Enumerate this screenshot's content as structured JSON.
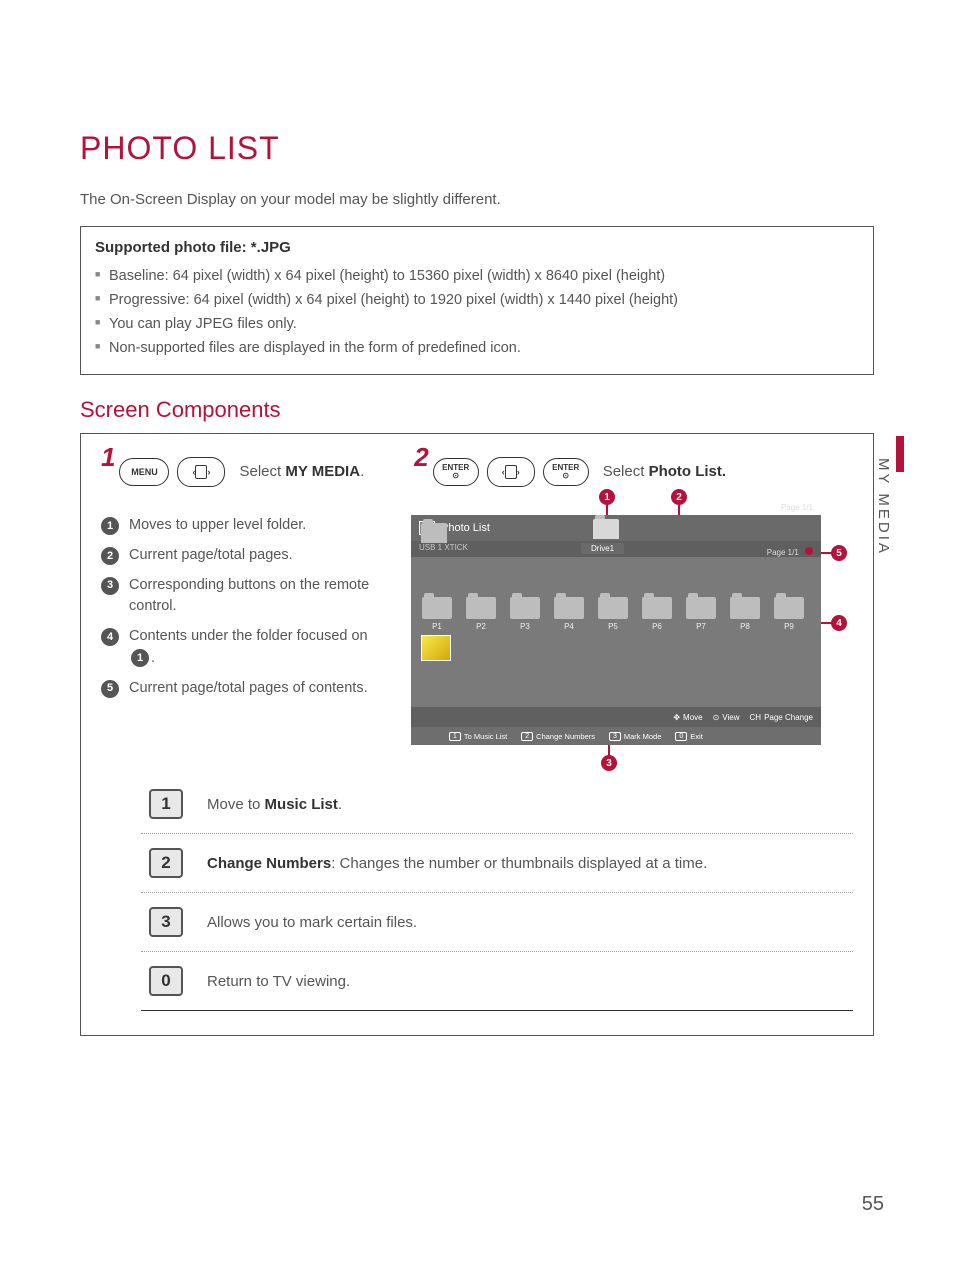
{
  "title": "PHOTO LIST",
  "intro": "The On-Screen Display on your model may be slightly different.",
  "support": {
    "heading": "Supported photo file: *.JPG",
    "items": [
      "Baseline: 64 pixel (width) x 64 pixel (height) to 15360 pixel (width) x 8640 pixel (height)",
      "Progressive: 64 pixel (width) x 64 pixel (height) to 1920 pixel (width) x 1440 pixel (height)",
      "You can play JPEG files only.",
      "Non-supported files are displayed in the form of predefined icon."
    ]
  },
  "screen_components_heading": "Screen Components",
  "steps": {
    "s1_num": "1",
    "s1_menu": "MENU",
    "s1_text_a": "Select ",
    "s1_text_b": "MY MEDIA",
    "s1_text_c": ".",
    "s2_num": "2",
    "s2_enter": "ENTER",
    "s2_text_a": "Select ",
    "s2_text_b": "Photo List.",
    "s2_text_c": ""
  },
  "legend": [
    {
      "n": "1",
      "t": "Moves to upper level folder."
    },
    {
      "n": "2",
      "t": "Current page/total pages."
    },
    {
      "n": "3",
      "t": "Corresponding buttons on the remote control."
    },
    {
      "n": "4",
      "t_a": "Contents under the folder focused on ",
      "t_icon": "1",
      "t_b": "."
    },
    {
      "n": "5",
      "t": "Current page/total pages of contents."
    }
  ],
  "mock": {
    "title": "Photo List",
    "sub": "USB 1 XTICK",
    "page_top": "Page 1/1",
    "drive_label": "Drive1",
    "page_sub": "Page 1/1",
    "cells": [
      "P1",
      "P2",
      "P3",
      "P4",
      "P5",
      "P6",
      "P7",
      "P8",
      "P9"
    ],
    "footer1": {
      "move": "Move",
      "view": "View",
      "pg": "Page Change"
    },
    "footer2": [
      {
        "k": "1",
        "t": "To Music List"
      },
      {
        "k": "2",
        "t": "Change Numbers"
      },
      {
        "k": "3",
        "t": "Mark Mode"
      },
      {
        "k": "0",
        "t": "Exit"
      }
    ]
  },
  "btn_table": [
    {
      "key": "1",
      "d_a": "Move to ",
      "d_b": "Music List",
      "d_c": "."
    },
    {
      "key": "2",
      "d_a": "",
      "d_b": "Change Numbers",
      "d_c": ": Changes the number or thumbnails displayed at a time."
    },
    {
      "key": "3",
      "d_a": "Allows you to mark certain files.",
      "d_b": "",
      "d_c": ""
    },
    {
      "key": "0",
      "d_a": "Return to TV viewing.",
      "d_b": "",
      "d_c": ""
    }
  ],
  "side_tab": "MY MEDIA",
  "page_number": "55"
}
